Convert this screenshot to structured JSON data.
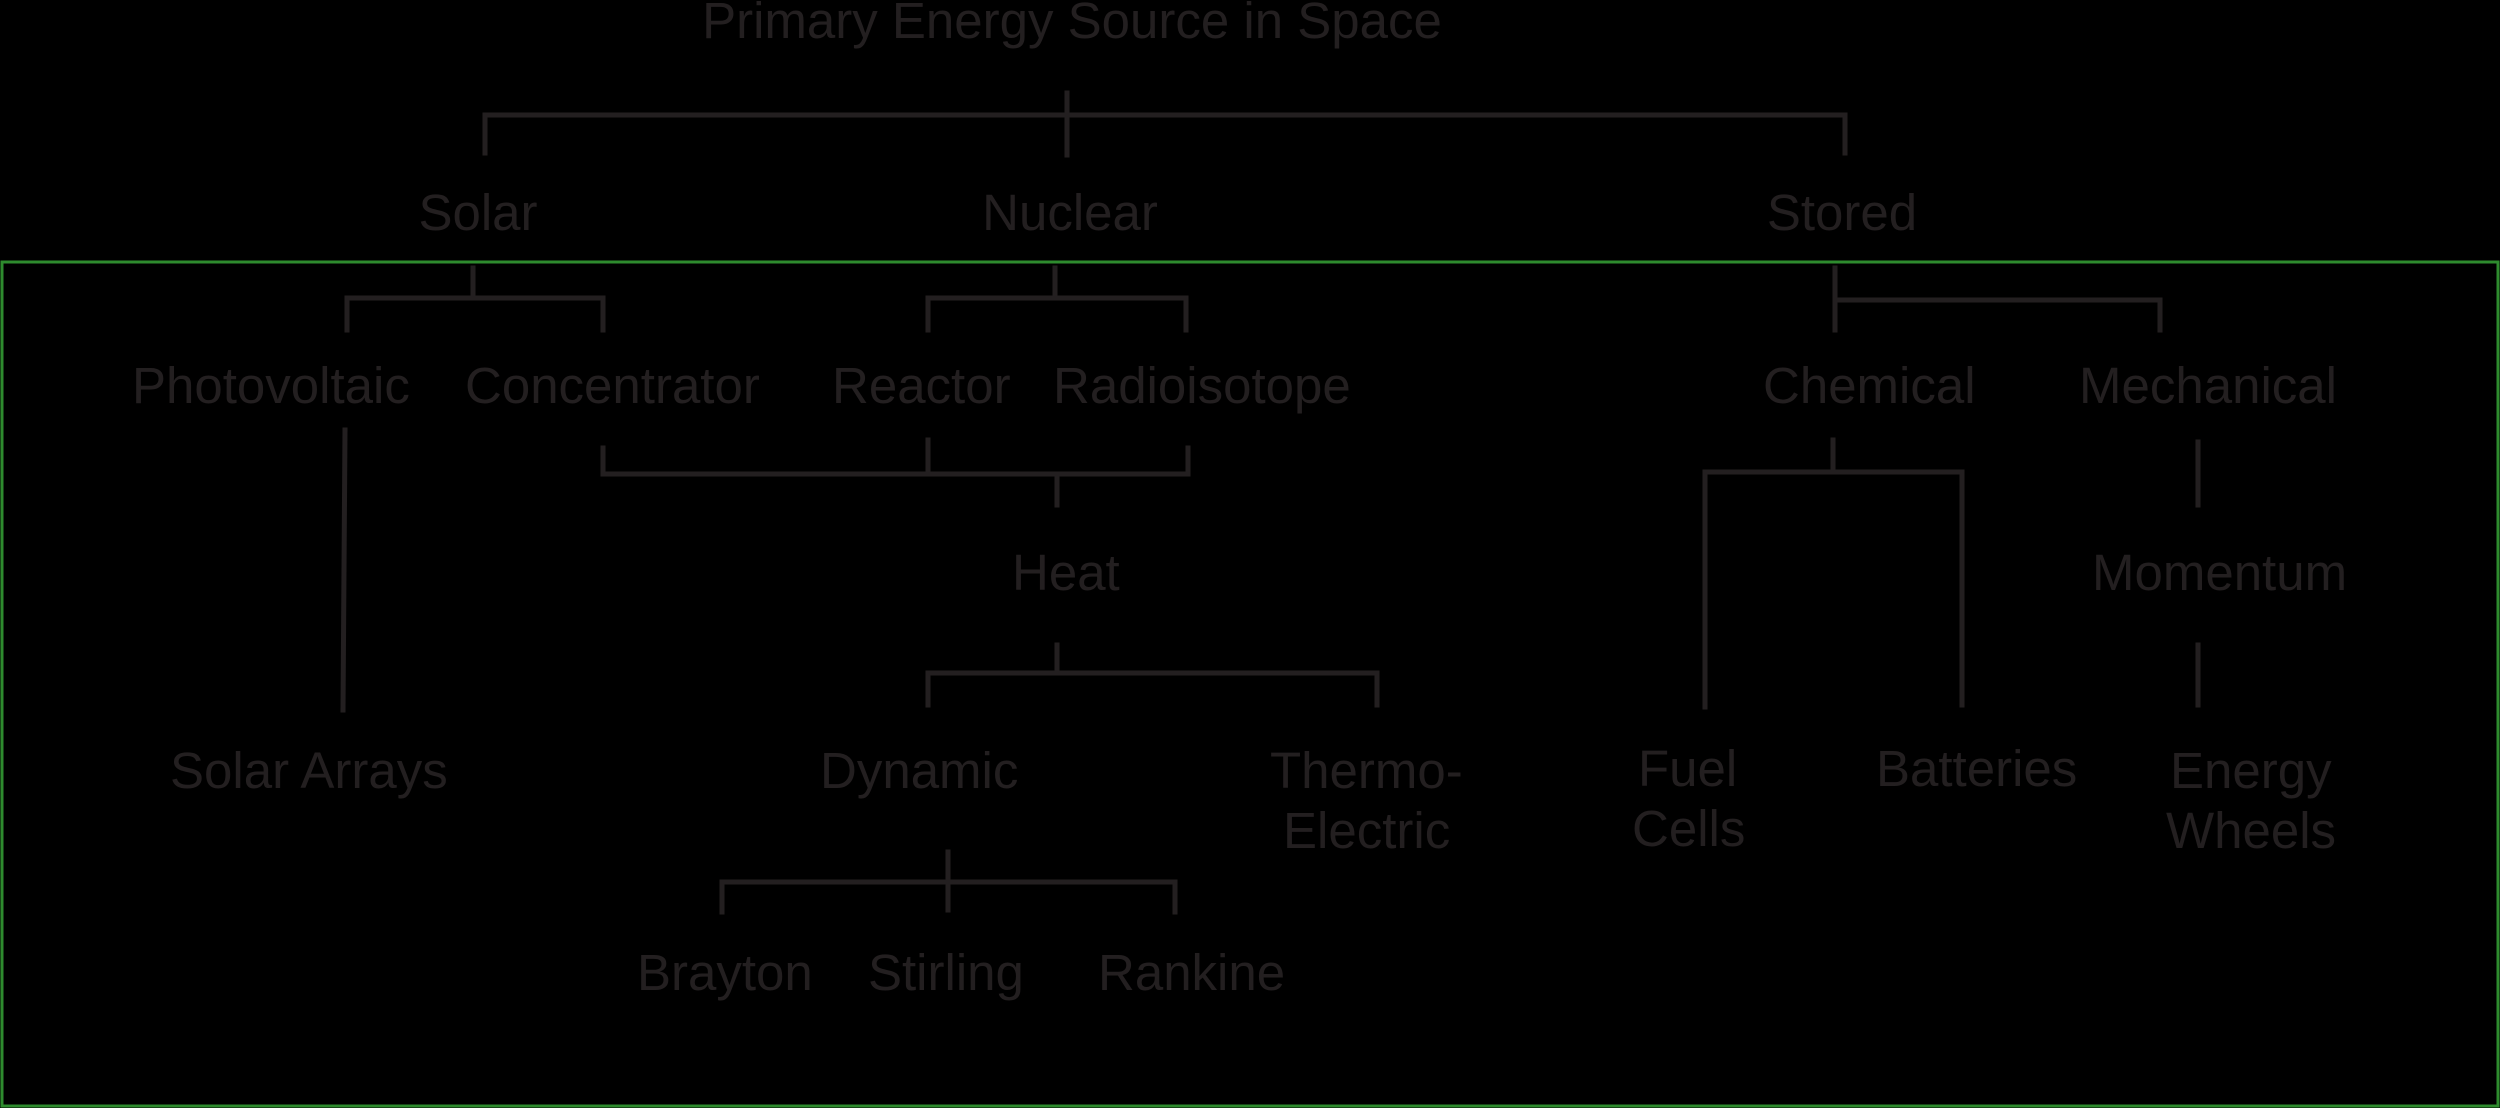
{
  "title": "Primary Energy Source in Space",
  "sources": {
    "solar": "Solar",
    "nuclear": "Nuclear",
    "stored": "Stored"
  },
  "solar": {
    "photovoltaic": "Photovoltaic",
    "concentrator": "Concentrator",
    "solar_arrays": "Solar Arrays"
  },
  "nuclear": {
    "reactor": "Reactor",
    "radioisotope": "Radioisotope"
  },
  "heat": {
    "label": "Heat",
    "dynamic": "Dynamic",
    "thermoelectric_line1": "Thermo-",
    "thermoelectric_line2": "Electric",
    "brayton": "Brayton",
    "stirling": "Stirling",
    "rankine": "Rankine"
  },
  "stored": {
    "chemical": "Chemical",
    "mechanical": "Mechanical",
    "fuel_cells_line1": "Fuel",
    "fuel_cells_line2": "Cells",
    "batteries": "Batteries",
    "momentum": "Momentum",
    "energy_wheels_line1": "Energy",
    "energy_wheels_line2": "Wheels"
  },
  "colors": {
    "background": "#000000",
    "text": "#231f20",
    "frame": "#2e8b2e"
  }
}
